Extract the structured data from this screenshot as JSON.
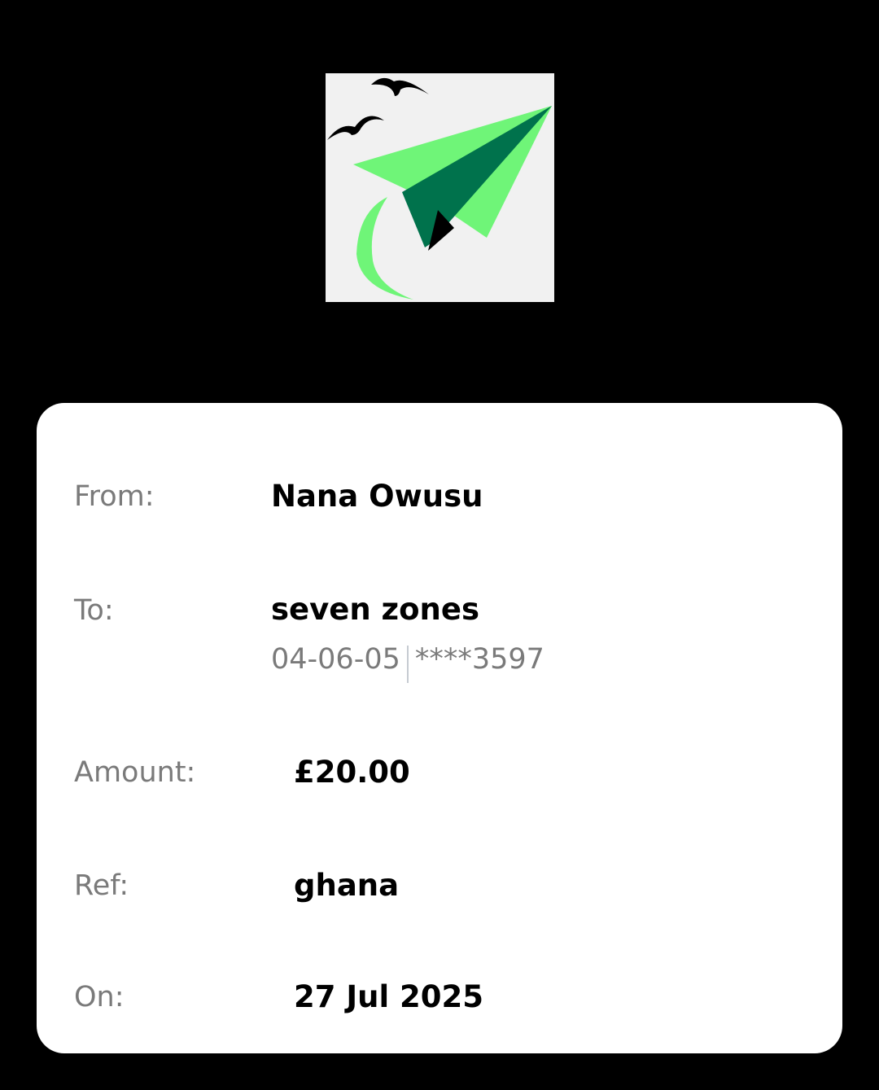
{
  "logo": {
    "icon": "paper-plane-birds-logo",
    "colors": {
      "background": "#f1f1f1",
      "plane_light": "#6ff578",
      "plane_dark": "#00724c",
      "trail": "#6ff578",
      "birds": "#000000"
    }
  },
  "receipt": {
    "from": {
      "label": "From:",
      "value": "Nana Owusu"
    },
    "to": {
      "label": "To:",
      "value": "seven zones",
      "sort_code": "04-06-05",
      "account": "****3597"
    },
    "amount": {
      "label": "Amount:",
      "value": "£20.00"
    },
    "ref": {
      "label": "Ref:",
      "value": "ghana"
    },
    "on": {
      "label": "On:",
      "value": "27 Jul 2025"
    }
  }
}
